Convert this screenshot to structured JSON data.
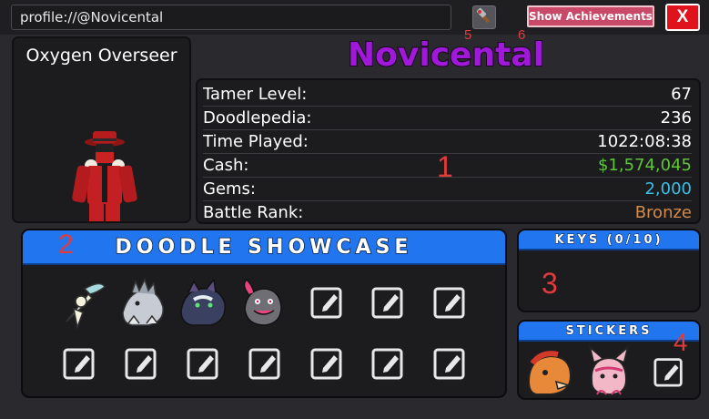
{
  "browser": {
    "url": "profile://@Novicental"
  },
  "toolbar": {
    "hammer_icon": "hammer-icon",
    "achievements_label": "Show Achievements",
    "close_label": "X"
  },
  "annotations": {
    "n1": "1",
    "n2": "2",
    "n3": "3",
    "n4": "4",
    "n5": "5",
    "n6": "6"
  },
  "profile": {
    "title": "Oxygen Overseer",
    "name": "Novicental",
    "name_color": "#a018d8",
    "stats": [
      {
        "label": "Tamer Level:",
        "value": "67",
        "color": "#ffffff"
      },
      {
        "label": "Doodlepedia:",
        "value": "236",
        "color": "#ffffff"
      },
      {
        "label": "Time Played:",
        "value": "1022:08:38",
        "color": "#ffffff"
      },
      {
        "label": "Cash:",
        "value": "$1,574,045",
        "color": "#5fc53a"
      },
      {
        "label": "Gems:",
        "value": "2,000",
        "color": "#3ac0e8"
      },
      {
        "label": "Battle Rank:",
        "value": "Bronze",
        "color": "#d48a4a"
      }
    ]
  },
  "showcase": {
    "title": "DOODLE SHOWCASE",
    "accent": "#2175ee"
  },
  "keys": {
    "title": "KEYS (0/10)"
  },
  "stickers": {
    "title": "STICKERS"
  }
}
